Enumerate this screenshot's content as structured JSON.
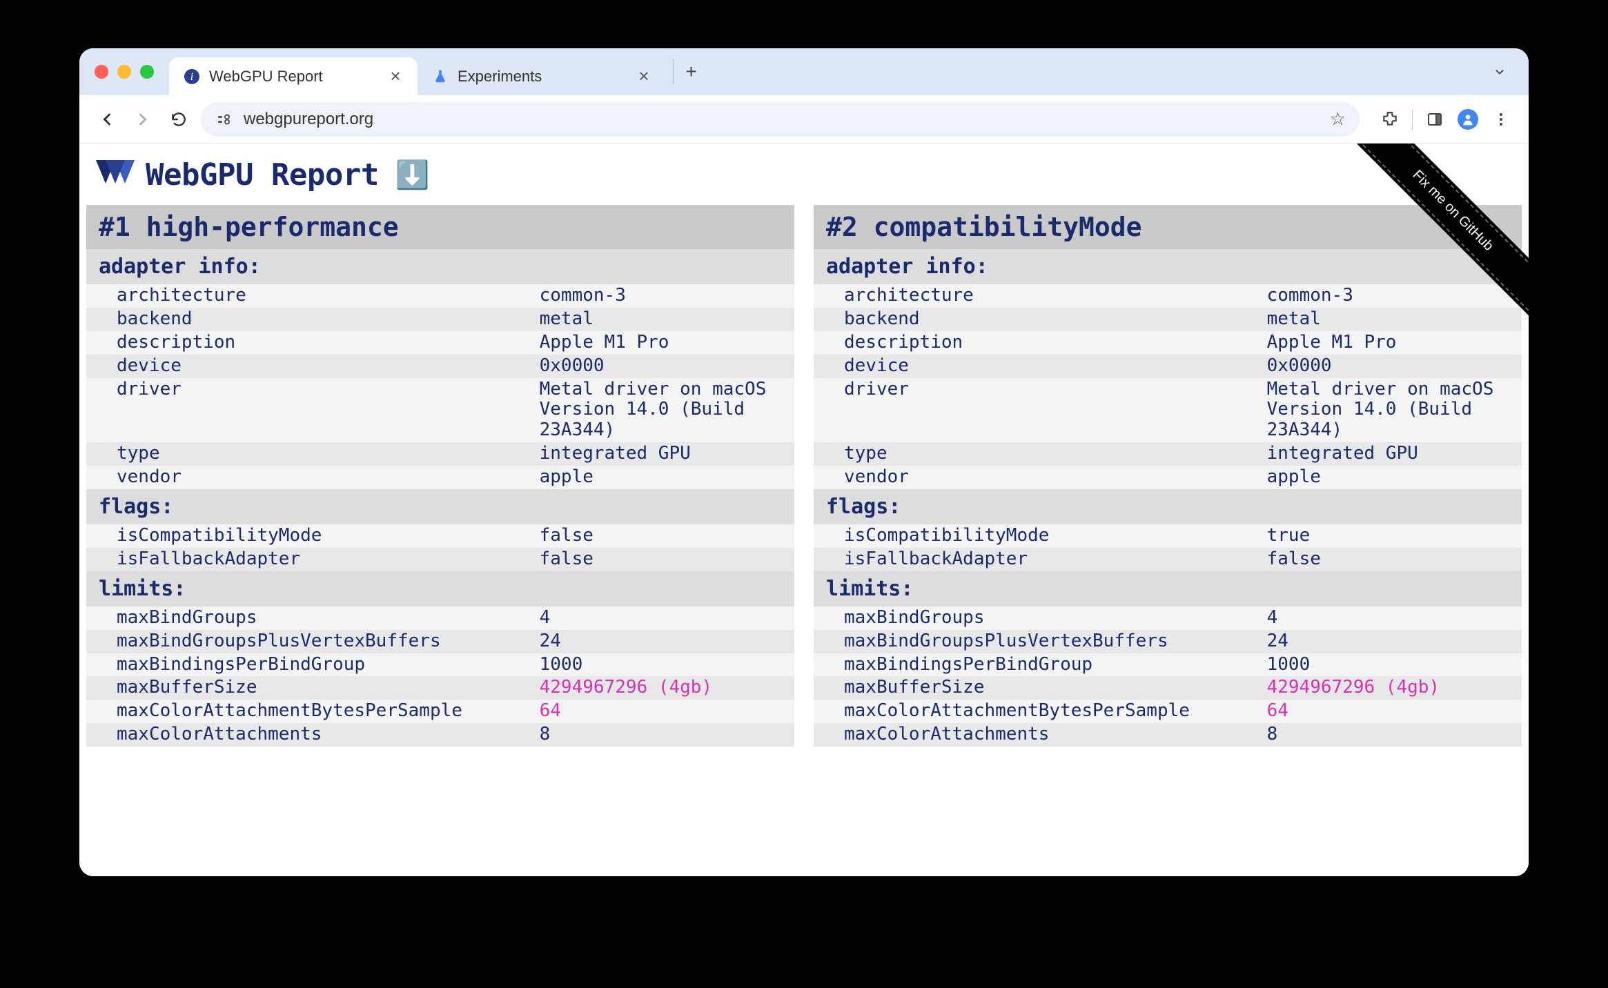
{
  "browser": {
    "tabs": [
      {
        "title": "WebGPU Report",
        "favicon": "info",
        "active": true
      },
      {
        "title": "Experiments",
        "favicon": "flask",
        "active": false
      }
    ],
    "url": "webgpureport.org"
  },
  "page": {
    "title": "WebGPU Report",
    "github_ribbon": "Fix me on GitHub"
  },
  "panels": [
    {
      "heading": "#1 high-performance",
      "sections": [
        {
          "title": "adapter info:",
          "rows": [
            {
              "k": "architecture",
              "v": "common-3"
            },
            {
              "k": "backend",
              "v": "metal"
            },
            {
              "k": "description",
              "v": "Apple M1 Pro"
            },
            {
              "k": "device",
              "v": "0x0000"
            },
            {
              "k": "driver",
              "v": "Metal driver on macOS Version 14.0 (Build 23A344)"
            },
            {
              "k": "type",
              "v": "integrated GPU"
            },
            {
              "k": "vendor",
              "v": "apple"
            }
          ]
        },
        {
          "title": "flags:",
          "rows": [
            {
              "k": "isCompatibilityMode",
              "v": "false"
            },
            {
              "k": "isFallbackAdapter",
              "v": "false"
            }
          ]
        },
        {
          "title": "limits:",
          "rows": [
            {
              "k": "maxBindGroups",
              "v": "4"
            },
            {
              "k": "maxBindGroupsPlusVertexBuffers",
              "v": "24"
            },
            {
              "k": "maxBindingsPerBindGroup",
              "v": "1000"
            },
            {
              "k": "maxBufferSize",
              "v": "4294967296 (4gb)",
              "special": true
            },
            {
              "k": "maxColorAttachmentBytesPerSample",
              "v": "64",
              "special": true
            },
            {
              "k": "maxColorAttachments",
              "v": "8"
            }
          ]
        }
      ]
    },
    {
      "heading": "#2 compatibilityMode",
      "sections": [
        {
          "title": "adapter info:",
          "rows": [
            {
              "k": "architecture",
              "v": "common-3"
            },
            {
              "k": "backend",
              "v": "metal"
            },
            {
              "k": "description",
              "v": "Apple M1 Pro"
            },
            {
              "k": "device",
              "v": "0x0000"
            },
            {
              "k": "driver",
              "v": "Metal driver on macOS Version 14.0 (Build 23A344)"
            },
            {
              "k": "type",
              "v": "integrated GPU"
            },
            {
              "k": "vendor",
              "v": "apple"
            }
          ]
        },
        {
          "title": "flags:",
          "rows": [
            {
              "k": "isCompatibilityMode",
              "v": "true"
            },
            {
              "k": "isFallbackAdapter",
              "v": "false"
            }
          ]
        },
        {
          "title": "limits:",
          "rows": [
            {
              "k": "maxBindGroups",
              "v": "4"
            },
            {
              "k": "maxBindGroupsPlusVertexBuffers",
              "v": "24"
            },
            {
              "k": "maxBindingsPerBindGroup",
              "v": "1000"
            },
            {
              "k": "maxBufferSize",
              "v": "4294967296 (4gb)",
              "special": true
            },
            {
              "k": "maxColorAttachmentBytesPerSample",
              "v": "64",
              "special": true
            },
            {
              "k": "maxColorAttachments",
              "v": "8"
            }
          ]
        }
      ]
    }
  ]
}
